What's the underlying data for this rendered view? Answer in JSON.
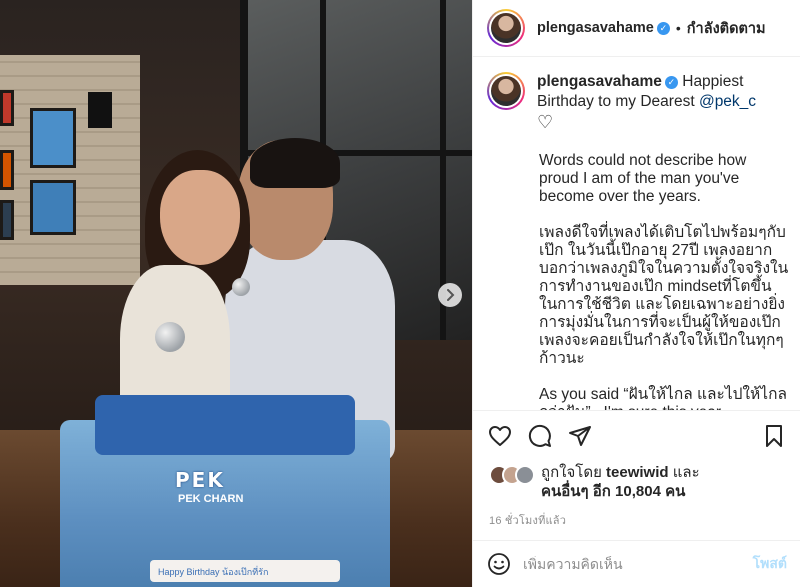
{
  "header": {
    "username": "plengasavahame",
    "separator": "•",
    "follow_label": "กำลังติดตาม"
  },
  "caption": {
    "username": "plengasavahame",
    "intro": " Happiest Birthday to my Dearest ",
    "mention": "@pek_c",
    "heart": "♡",
    "paragraphs": [
      "Words could not describe how proud I am of the man you've become over the years.",
      "เพลงดีใจที่เพลงได้เติบโตไปพร้อมๆกับเป๊ก ในวันนี้เป๊กอายุ 27ปี เพลงอยากบอกว่าเพลงภูมิใจในความตั้งใจจริงในการทำงานของเป๊ก mindsetที่โตขึ้นในการใช้ชีวิต และโดยเฉพาะอย่างยิ่งการมุ่งมั่นในการที่จะเป็นผู้ให้ของเป๊ก เพลงจะคอยเป็นกำลังใจให้เป๊กในทุกๆก้าวนะ",
      "As you said “ฝันให้ไกล และไปให้ไกลกว่าฝัน” , I'm sure this year"
    ]
  },
  "photo": {
    "cake_name": "PEK",
    "cake_sub": "PEK CHARN",
    "cake_banner": "Happy Birthday น้องเป๊กที่รัก"
  },
  "likes": {
    "liked_by_prefix": "ถูกใจโดย ",
    "liked_by_user": "teewiwid",
    "and": " และ",
    "others": "คนอื่นๆ อีก 10,804 คน"
  },
  "timestamp": "16 ชั่วโมงที่แล้ว",
  "comment": {
    "placeholder": "เพิ่มความคิดเห็น",
    "post_label": "โพสต์"
  },
  "icons": {
    "like": "heart-outline",
    "comment": "speech-bubble",
    "share": "paper-plane",
    "save": "bookmark",
    "emoji": "smiley",
    "next": "chevron-right",
    "verified": "blue-check"
  },
  "colors": {
    "verified": "#3897f0",
    "mention": "#00376b",
    "post_button": "#b2dffc",
    "timestamp": "#8e8e8e"
  }
}
